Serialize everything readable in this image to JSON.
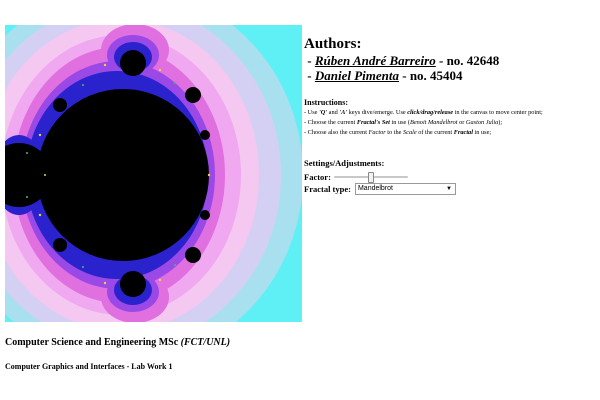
{
  "authors": {
    "title": "Authors:",
    "list": [
      {
        "prefix": " - ",
        "name": "Rúben André Barreiro",
        "suffix": " - no. 42648"
      },
      {
        "prefix": " - ",
        "name": "Daniel Pimenta",
        "suffix": " - no. 45404"
      }
    ]
  },
  "instructions": {
    "title": "Instructions:",
    "line1": {
      "t1": "- Use ",
      "k1": "'Q'",
      "t2": " and ",
      "k2": "'A'",
      "t3": " keys dive/emerge. Use ",
      "k3": "click/drag/release",
      "t4": " in the canvas to move center point;"
    },
    "line2": {
      "t1": "- Choose the current ",
      "k1": "Fractal's Set",
      "t2": " in use (",
      "k2": "Benoit Mandelbrot",
      "t3": " or ",
      "k3": "Gaston Julia",
      "t4": ");"
    },
    "line3": {
      "t1": "- Choose also the current ",
      "k1": "Factor",
      "t2": " to the ",
      "k2": "Scale",
      "t3": " of the current ",
      "k3": "Fractal",
      "t4": " in use;"
    }
  },
  "settings": {
    "title": "Settings/Adjustments:",
    "factor_label": "Factor:",
    "factor_value": 0.5,
    "fractal_type_label": "Fractal type:",
    "fractal_type_selected": "Mandelbrot",
    "fractal_type_arrow": "▼"
  },
  "footer": {
    "course": "Computer Science and Engineering MSc ",
    "course_suffix": "(FCT/UNL)",
    "lab": "Computer Graphics and Interfaces - Lab Work 1"
  },
  "colors": {
    "outer": "#5ef0f5",
    "set": "#000000",
    "pink": "#f0a8f0",
    "magenta": "#e060e0",
    "violet": "#9040e8",
    "blue": "#2020d0"
  }
}
